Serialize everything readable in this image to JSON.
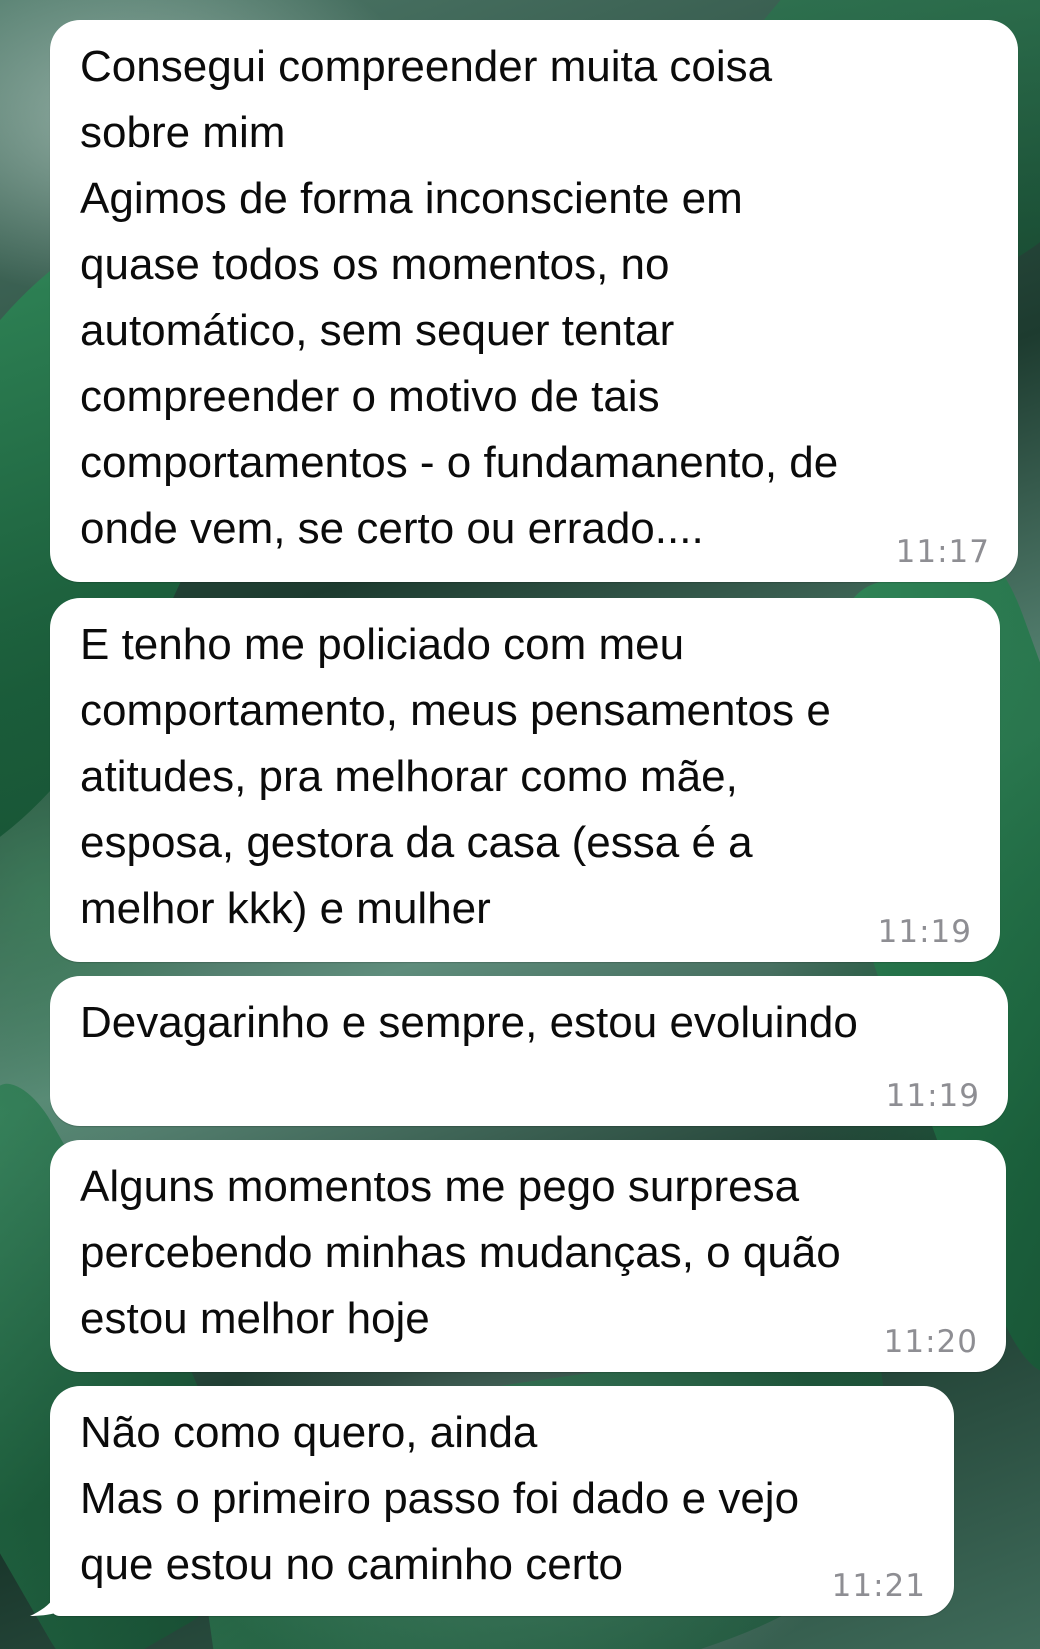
{
  "colors": {
    "bubble_background": "#ffffff",
    "message_text": "#0b0b0b",
    "timestamp_text": "#8e8e93",
    "wallpaper_theme": "#2f4a3f"
  },
  "messages": [
    {
      "lines": [
        "Consegui compreender muita coisa",
        "sobre mim",
        "Agimos de forma inconsciente em",
        "quase todos os momentos, no",
        "automático, sem sequer tentar",
        "compreender o motivo de tais",
        "comportamentos - o fundamanento, de",
        "onde vem, se certo ou errado...."
      ],
      "time": "11:17"
    },
    {
      "lines": [
        "E tenho me policiado com meu",
        "comportamento, meus pensamentos e",
        "atitudes, pra melhorar como mãe,",
        "esposa, gestora da casa (essa é a",
        "melhor kkk) e mulher"
      ],
      "time": "11:19"
    },
    {
      "lines": [
        "Devagarinho e sempre, estou evoluindo"
      ],
      "time": "11:19"
    },
    {
      "lines": [
        "Alguns momentos me pego surpresa",
        "percebendo minhas mudanças, o quão",
        "estou melhor hoje"
      ],
      "time": "11:20"
    },
    {
      "lines": [
        "Não como quero, ainda",
        "Mas o primeiro passo foi dado e vejo",
        "que estou no caminho certo"
      ],
      "time": "11:21"
    }
  ]
}
